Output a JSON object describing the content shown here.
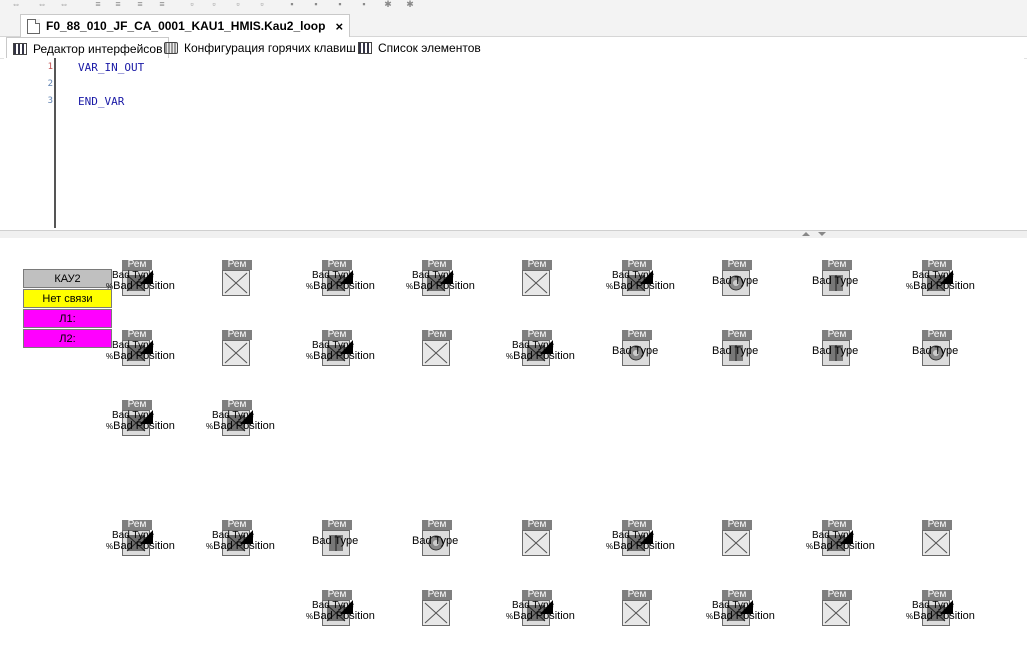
{
  "document": {
    "tab_title": "F0_88_010_JF_CA_0001_KAU1_HMIS.Kau2_loop",
    "close_label": "×"
  },
  "subtabs": [
    {
      "label": "Редактор интерфейсов",
      "icon": "interface-editor-icon"
    },
    {
      "label": "Конфигурация горячих клавиш",
      "icon": "keyboard-icon"
    },
    {
      "label": "Список элементов",
      "icon": "element-list-icon"
    }
  ],
  "editor": {
    "line_numbers": [
      "1",
      "2",
      "3"
    ],
    "lines": [
      "VAR_IN_OUT",
      "",
      "END_VAR"
    ]
  },
  "kau_panel": {
    "title": "КАУ2",
    "status": "Нет связи",
    "l1": "Л1:",
    "l2": "Л2:",
    "colors": {
      "title_bg": "#c0c0c0",
      "status_bg": "#ffff00",
      "line_bg": "#ff00ff"
    }
  },
  "widget_texts": {
    "header": "Рем",
    "bad_type": "Bad Type",
    "bad_position": "Bad Position",
    "pct": "%"
  },
  "widgets": [
    {
      "kind": "full",
      "icon": "valve-icon"
    },
    {
      "kind": "blank",
      "icon": "cross-icon"
    },
    {
      "kind": "full",
      "icon": "valve-icon"
    },
    {
      "kind": "full",
      "icon": "valve-icon"
    },
    {
      "kind": "blank",
      "icon": "cross-icon"
    },
    {
      "kind": "full",
      "icon": "valve-icon"
    },
    {
      "kind": "type",
      "icon": "round-icon"
    },
    {
      "kind": "type",
      "icon": "pump-icon"
    },
    {
      "kind": "full",
      "icon": "valve-icon"
    },
    {
      "kind": "full",
      "icon": "valve-icon"
    },
    {
      "kind": "blank",
      "icon": "cross-icon"
    },
    {
      "kind": "full",
      "icon": "valve-icon"
    },
    {
      "kind": "blank",
      "icon": "cross-icon"
    },
    {
      "kind": "full",
      "icon": "valve-icon"
    },
    {
      "kind": "type",
      "icon": "round-icon"
    },
    {
      "kind": "type",
      "icon": "pump-icon"
    },
    {
      "kind": "type",
      "icon": "pump-icon"
    },
    {
      "kind": "type",
      "icon": "round-icon"
    },
    {
      "kind": "full",
      "icon": "valve-icon"
    },
    {
      "kind": "full",
      "icon": "valve-icon"
    },
    {
      "kind": "full",
      "icon": "valve-icon"
    },
    {
      "kind": "full",
      "icon": "valve-icon"
    },
    {
      "kind": "type",
      "icon": "pump-icon"
    },
    {
      "kind": "type",
      "icon": "round-icon"
    },
    {
      "kind": "blank",
      "icon": "cross-icon"
    },
    {
      "kind": "full",
      "icon": "valve-icon"
    },
    {
      "kind": "blank",
      "icon": "cross-icon"
    },
    {
      "kind": "full",
      "icon": "valve-icon"
    },
    {
      "kind": "blank",
      "icon": "cross-icon"
    },
    {
      "kind": "full",
      "icon": "valve-icon"
    },
    {
      "kind": "blank",
      "icon": "cross-icon"
    },
    {
      "kind": "full",
      "icon": "valve-icon"
    },
    {
      "kind": "blank",
      "icon": "cross-icon"
    },
    {
      "kind": "full",
      "icon": "valve-icon"
    },
    {
      "kind": "blank",
      "icon": "cross-icon"
    },
    {
      "kind": "full",
      "icon": "valve-icon"
    }
  ]
}
